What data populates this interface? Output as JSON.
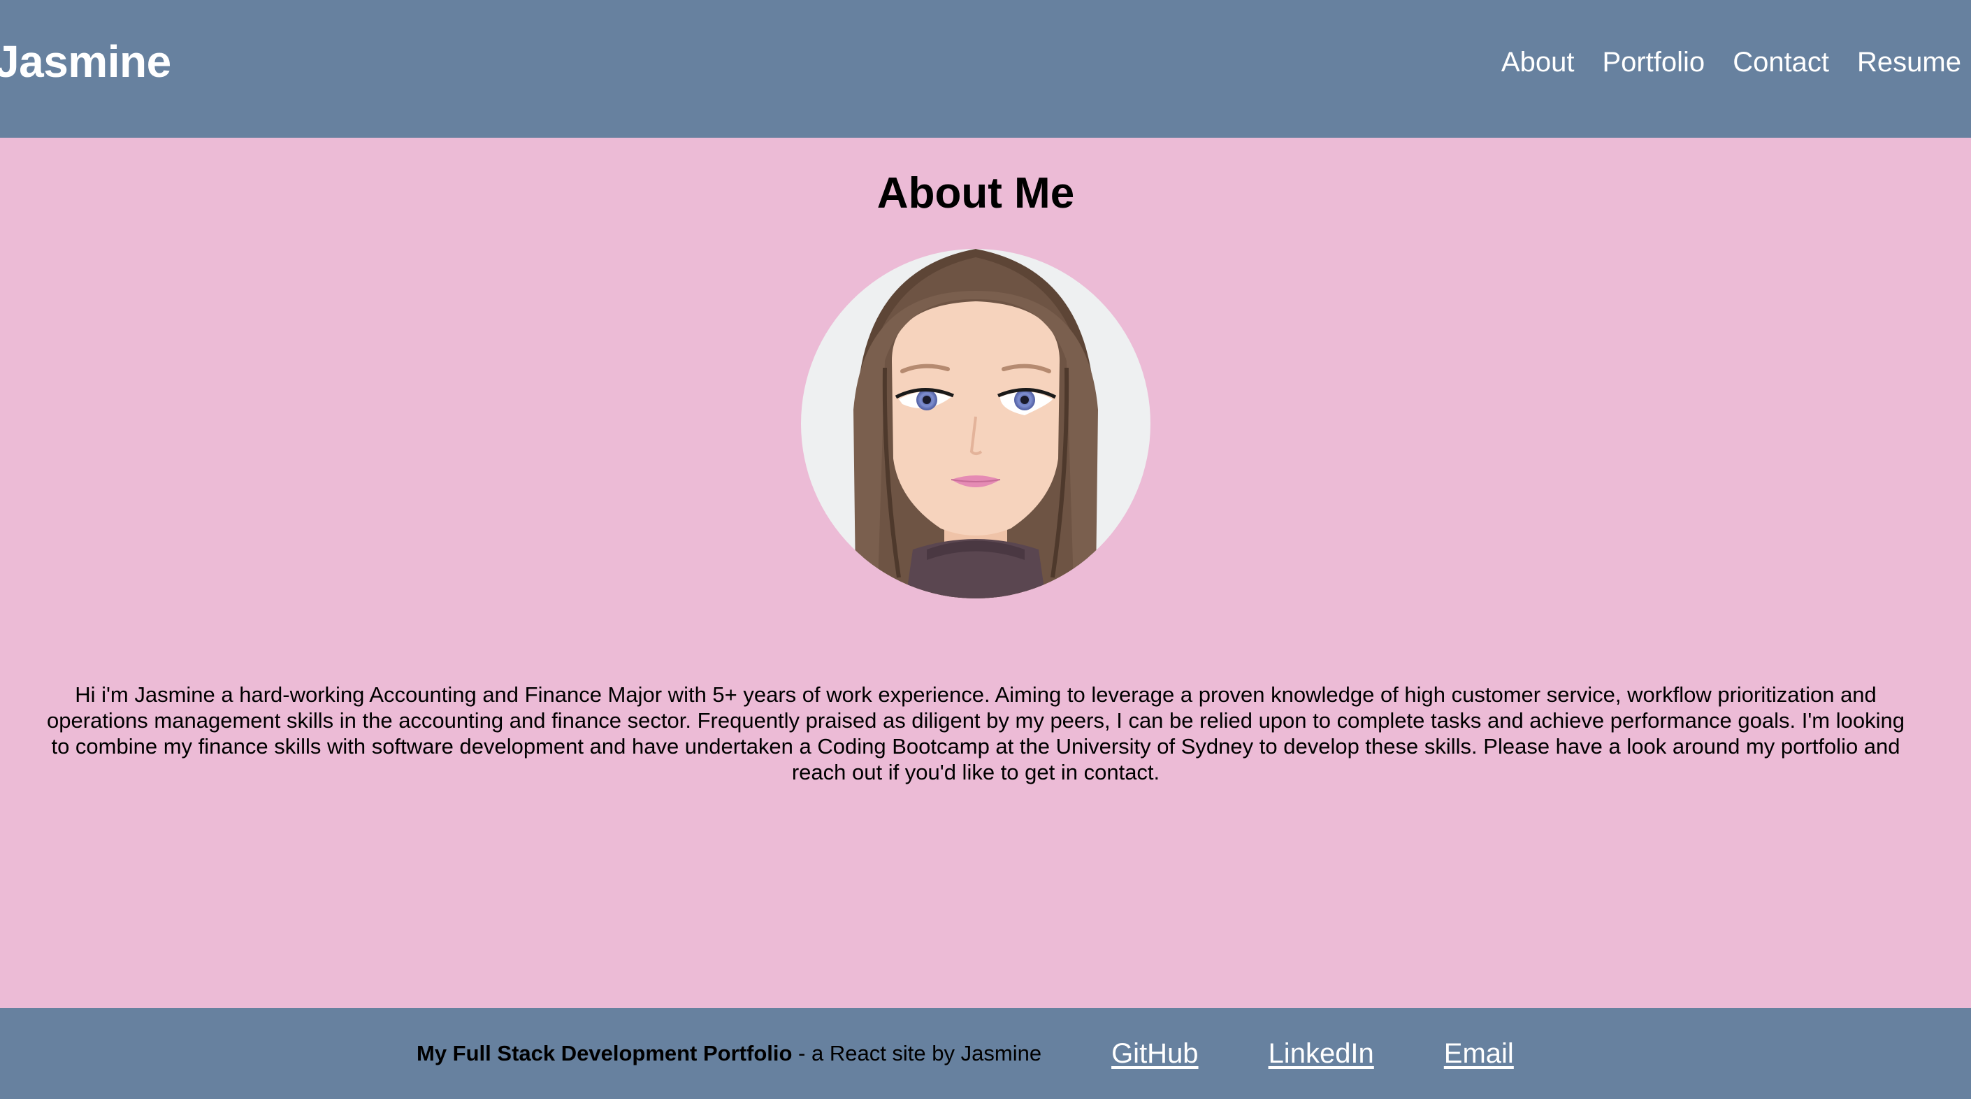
{
  "header": {
    "brand": "Jasmine",
    "nav": [
      {
        "label": "About"
      },
      {
        "label": "Portfolio"
      },
      {
        "label": "Contact"
      },
      {
        "label": "Resume"
      }
    ]
  },
  "main": {
    "title": "About Me",
    "avatar_icon": "female-avatar-illustration",
    "bio": "Hi i'm Jasmine a hard-working Accounting and Finance Major with 5+ years of work experience. Aiming to leverage a proven knowledge of high customer service, workflow prioritization and operations management skills in the accounting and finance sector. Frequently praised as diligent by my peers, I can be relied upon to complete tasks and achieve performance goals. I'm looking to combine my finance skills with software development and have undertaken a Coding Bootcamp at the University of Sydney to develop these skills. Please have a look around my portfolio and reach out if you'd like to get in contact."
  },
  "footer": {
    "tagline_bold": "My Full Stack Development Portfolio",
    "tagline_rest": " - a React site by Jasmine",
    "links": [
      {
        "label": "GitHub"
      },
      {
        "label": "LinkedIn"
      },
      {
        "label": "Email"
      }
    ]
  },
  "colors": {
    "header_bg": "#67819f",
    "page_bg": "#ecbbd6",
    "avatar_bg": "#eef0f1",
    "hair": "#6e5444",
    "skin": "#f6d3bd",
    "eyes": "#7f8fd0",
    "lips": "#e58bb4",
    "top": "#5a4650"
  }
}
